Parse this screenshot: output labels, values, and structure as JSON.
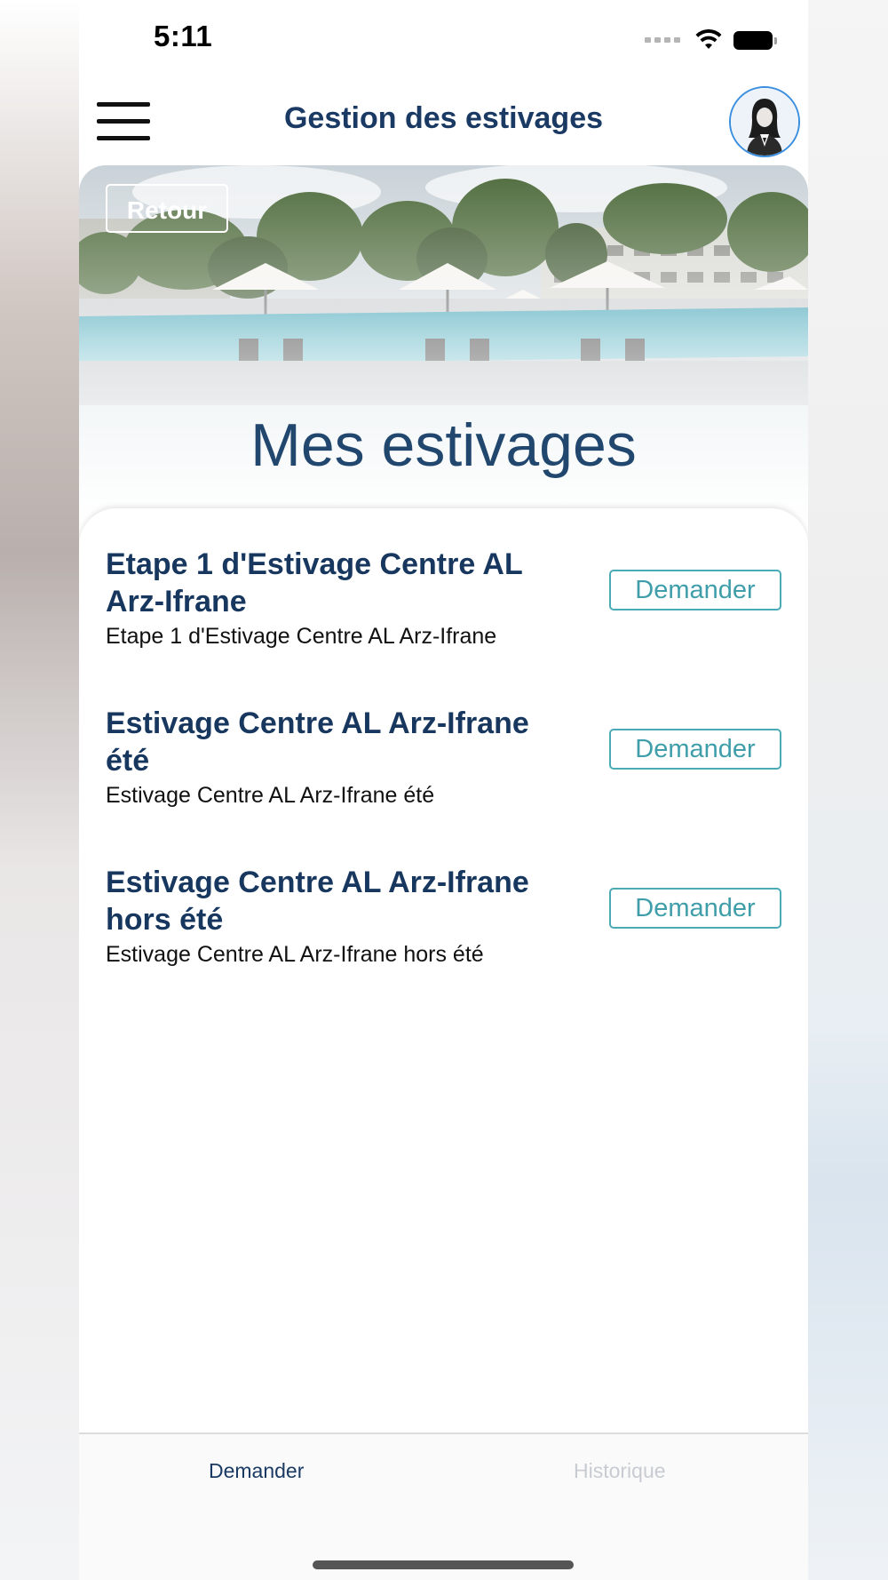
{
  "status": {
    "time": "5:11"
  },
  "header": {
    "title": "Gestion des estivages"
  },
  "hero": {
    "back_label": "Retour",
    "title": "Mes estivages"
  },
  "items": [
    {
      "title": "Etape 1 d'Estivage Centre AL Arz-Ifrane",
      "subtitle": "Etape 1 d'Estivage Centre AL Arz-Ifrane",
      "action": "Demander"
    },
    {
      "title": "Estivage Centre AL Arz-Ifrane été",
      "subtitle": "Estivage Centre AL Arz-Ifrane été",
      "action": "Demander"
    },
    {
      "title": "Estivage Centre AL Arz-Ifrane hors été",
      "subtitle": "Estivage Centre AL Arz-Ifrane hors été",
      "action": "Demander"
    }
  ],
  "tabs": [
    {
      "label": "Demander",
      "active": true
    },
    {
      "label": "Historique",
      "active": false
    }
  ],
  "colors": {
    "primary": "#1a3a64",
    "accent": "#4aaab5",
    "avatar_border": "#3a8ee0"
  },
  "icons": {
    "menu": "hamburger-icon",
    "avatar": "user-avatar-icon",
    "wifi": "wifi-icon",
    "battery": "battery-icon",
    "signal": "cellular-signal-icon"
  }
}
